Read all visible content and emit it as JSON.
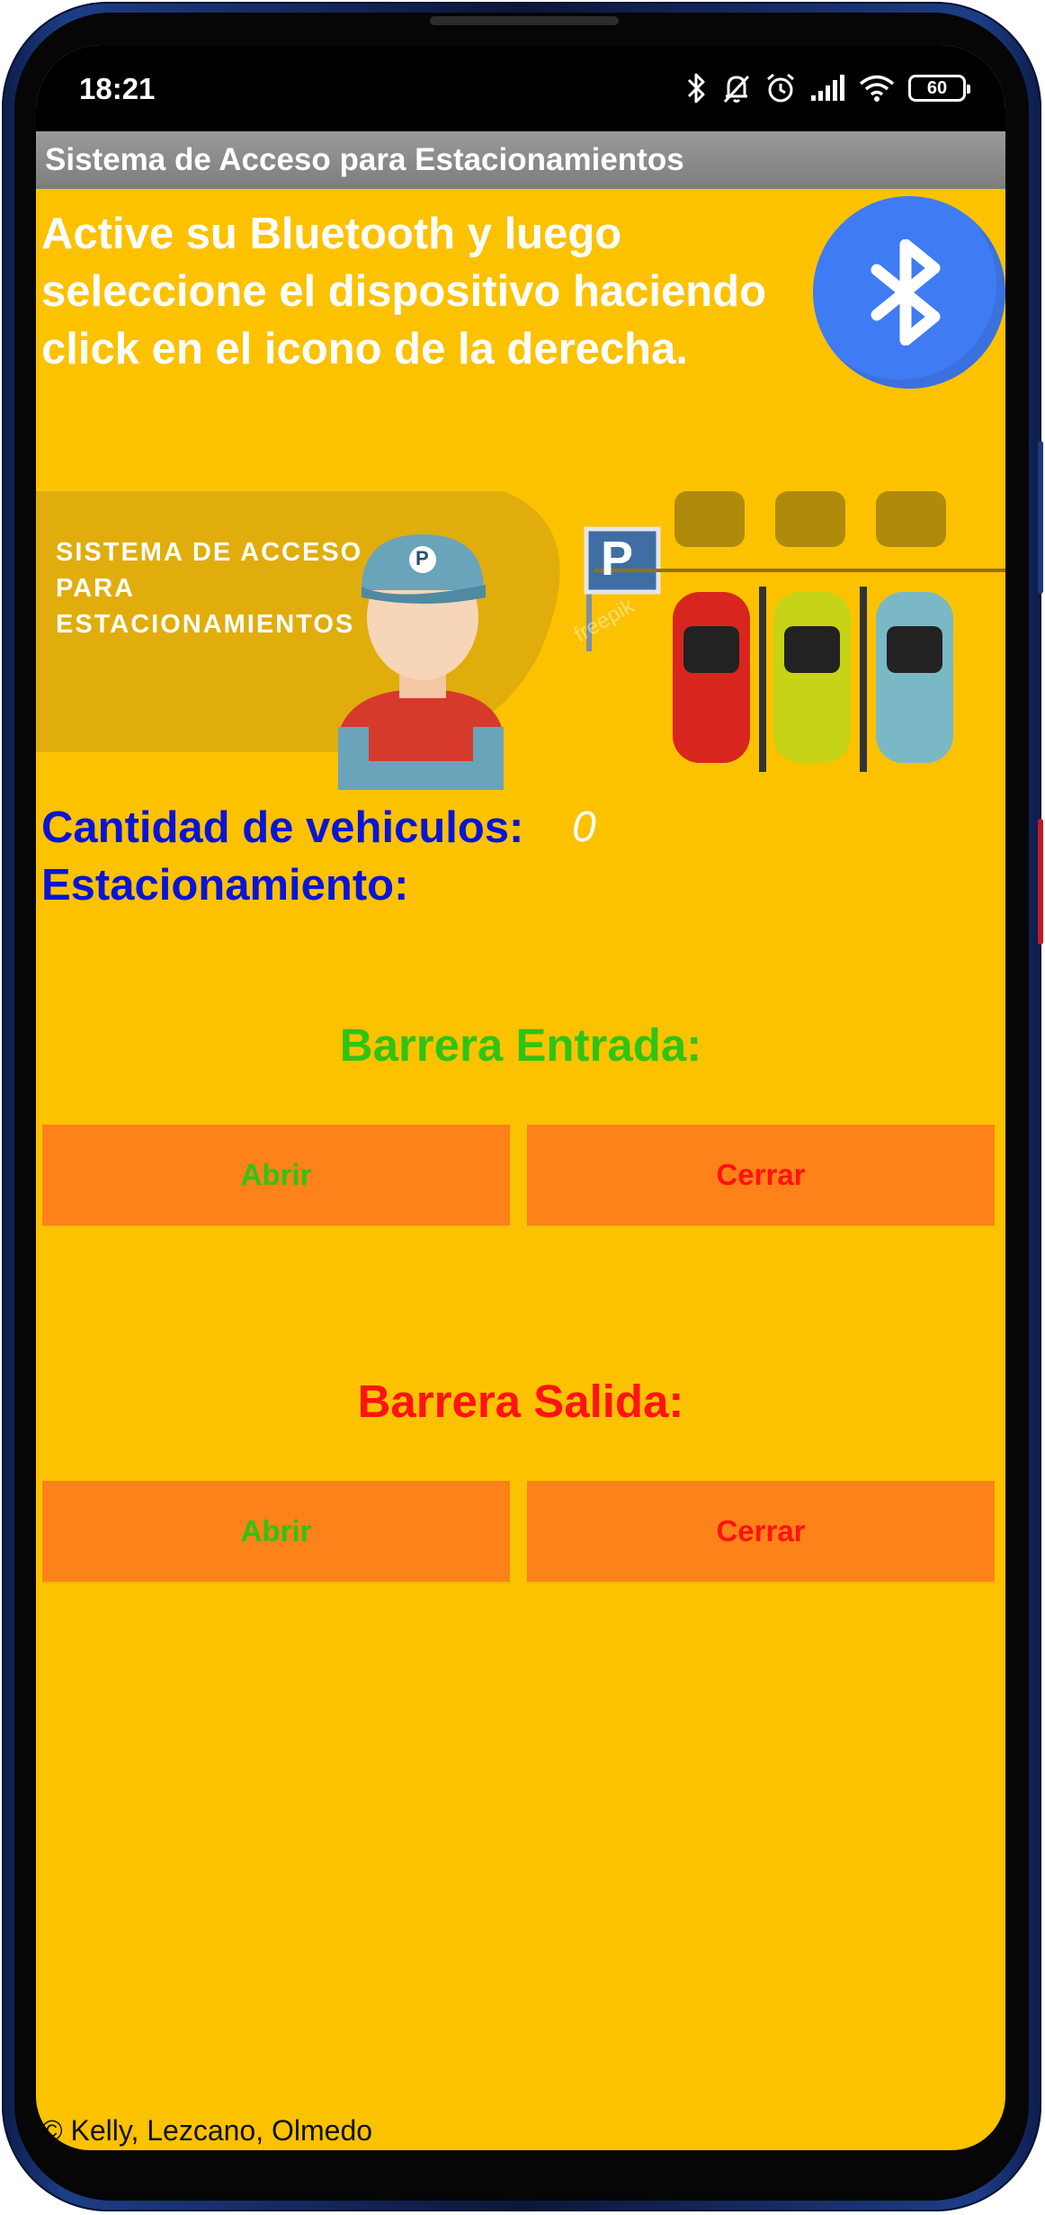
{
  "status_bar": {
    "time": "18:21",
    "battery": "60",
    "icons": [
      "bluetooth-icon",
      "bell-muted-icon",
      "alarm-icon",
      "signal-icon",
      "wifi-icon",
      "battery-icon"
    ]
  },
  "app": {
    "title": "Sistema de Acceso para Estacionamientos"
  },
  "instructions": {
    "line1": "Active su Bluetooth y luego",
    "line2": "seleccione el dispositivo haciendo",
    "line3": "click en el icono de la derecha."
  },
  "bluetooth_button": {
    "icon": "bluetooth-icon",
    "color": "#3f7bf2"
  },
  "banner": {
    "line1": "SISTEMA DE ACCESO",
    "line2": "PARA",
    "line3": "ESTACIONAMIENTOS",
    "sign": "P",
    "cap_letter": "P",
    "watermark": "freepik"
  },
  "stats": {
    "vehicle_count_label": "Cantidad de vehiculos:",
    "vehicle_count_value": "0",
    "parking_label": "Estacionamiento:",
    "parking_value": ""
  },
  "entry_barrier": {
    "title": "Barrera Entrada:",
    "open_label": "Abrir",
    "close_label": "Cerrar"
  },
  "exit_barrier": {
    "title": "Barrera Salida:",
    "open_label": "Abrir",
    "close_label": "Cerrar"
  },
  "footer": {
    "text": "© Kelly, Lezcano, Olmedo"
  },
  "colors": {
    "background": "#fcc200",
    "button": "#fc8219",
    "open_text": "#2fc415",
    "close_text": "#ff1313",
    "label_blue": "#0a14d6",
    "entry_title": "#2fc415",
    "exit_title": "#ff1313",
    "titlebar": "#8a8a8a"
  }
}
